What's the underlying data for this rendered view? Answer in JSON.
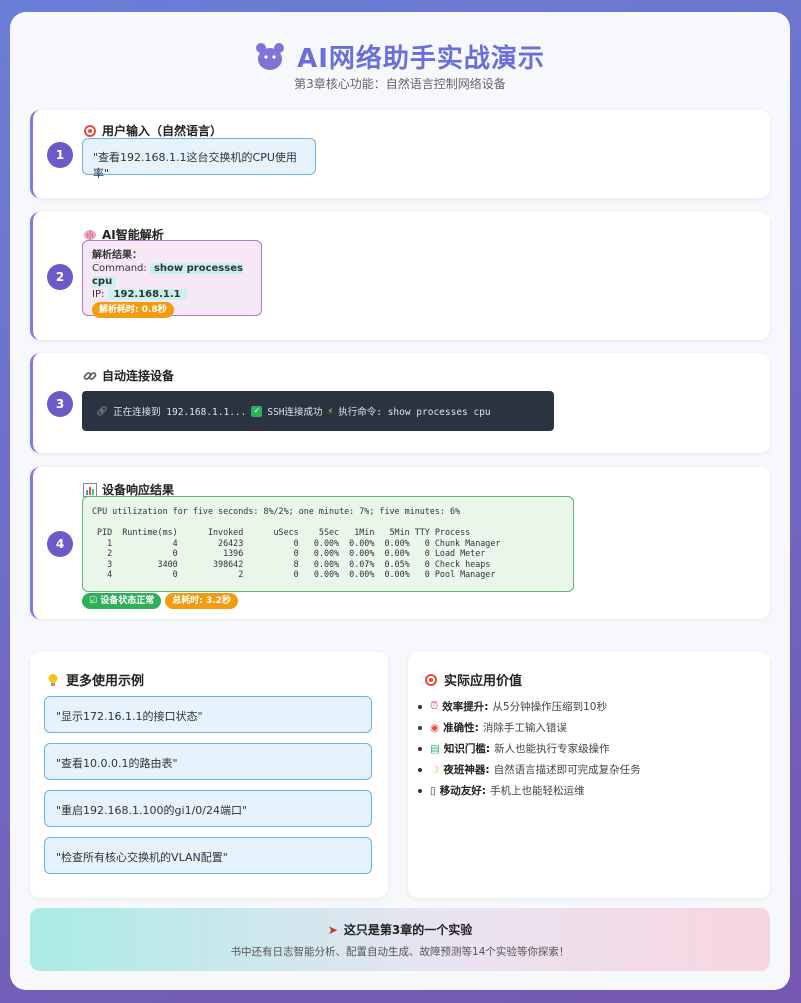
{
  "header": {
    "title": "AI网络助手实战演示",
    "subtitle": "第3章核心功能：自然语言控制网络设备"
  },
  "steps": [
    {
      "num": "1",
      "title": "用户输入（自然语言）",
      "content": "\"查看192.168.1.1这台交换机的CPU使用率\""
    },
    {
      "num": "2",
      "title": "AI智能解析",
      "parse_label": "解析结果：",
      "command_label": "Command:",
      "command_value": "show processes cpu",
      "ip_label": "IP:",
      "ip_value": "192.168.1.1",
      "time_badge": "解析耗时: 0.8秒"
    },
    {
      "num": "3",
      "title": "自动连接设备",
      "connecting": "正在连接到 192.168.1.1...",
      "ssh_ok": "SSH连接成功",
      "exec": "执行命令: show processes cpu"
    },
    {
      "num": "4",
      "title": "设备响应结果",
      "output": "CPU utilization for five seconds: 8%/2%; one minute: 7%; five minutes: 6%\n\n PID  Runtime(ms)      Invoked      uSecs    5Sec   1Min   5Min TTY Process\n   1            4        26423          0   0.00%  0.00%  0.00%   0 Chunk Manager\n   2            0         1396          0   0.00%  0.00%  0.00%   0 Load Meter\n   3         3400       398642          8   0.00%  0.07%  0.05%   0 Check heaps\n   4            0            2          0   0.00%  0.00%  0.00%   0 Pool Manager",
      "status_badge": "设备状态正常",
      "time_badge": "总耗时: 3.2秒"
    }
  ],
  "examples": {
    "title": "更多使用示例",
    "items": [
      "\"显示172.16.1.1的接口状态\"",
      "\"查看10.0.0.1的路由表\"",
      "\"重启192.168.1.100的gi1/0/24端口\"",
      "\"检查所有核心交换机的VLAN配置\""
    ]
  },
  "value": {
    "title": "实际应用价值",
    "items": [
      {
        "label": "效率提升:",
        "text": "从5分钟操作压缩到10秒"
      },
      {
        "label": "准确性:",
        "text": "消除手工输入错误"
      },
      {
        "label": "知识门槛:",
        "text": "新人也能执行专家级操作"
      },
      {
        "label": "夜班神器:",
        "text": "自然语言描述即可完成复杂任务"
      },
      {
        "label": "移动友好:",
        "text": "手机上也能轻松运维"
      }
    ]
  },
  "footer": {
    "title": "这只是第3章的一个实验",
    "subtitle": "书中还有日志智能分析、配置自动生成、故障预测等14个实验等你探索！"
  },
  "colors": {
    "accent": "#6b6fd8",
    "step_number": "#6a5bc7",
    "ok": "#2eaf5a",
    "warn": "#f39c12"
  }
}
